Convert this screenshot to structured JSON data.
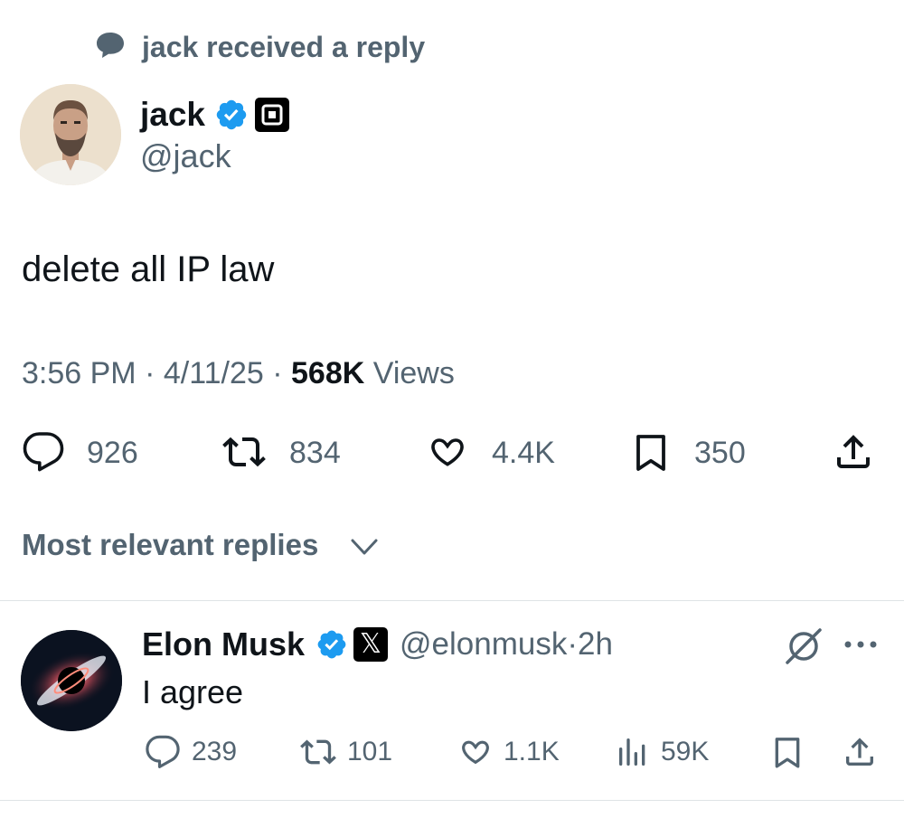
{
  "social_context": {
    "text": "jack received a reply"
  },
  "tweet": {
    "author_name": "jack",
    "author_handle": "@jack",
    "text": "delete all IP law",
    "time": "3:56 PM",
    "date": "4/11/25",
    "views_count": "568K",
    "views_label": "Views",
    "separator": "·",
    "stats": {
      "replies": "926",
      "retweets": "834",
      "likes": "4.4K",
      "bookmarks": "350"
    }
  },
  "replies_sort": {
    "label": "Most relevant replies"
  },
  "reply": {
    "author_name": "Elon Musk",
    "author_handle": "@elonmusk",
    "separator": "·",
    "age": "2h",
    "text": "I agree",
    "x_logo_text": "𝕏",
    "stats": {
      "replies": "239",
      "retweets": "101",
      "likes": "1.1K",
      "views": "59K"
    }
  },
  "colors": {
    "text_primary": "#0f1419",
    "text_secondary": "#536471",
    "verified_blue": "#1d9bf0",
    "divider": "#dfe3e6"
  },
  "icons": [
    "speech-bubble-icon",
    "verified-badge-icon",
    "square-logo-icon",
    "reply-icon",
    "retweet-icon",
    "like-icon",
    "bookmark-icon",
    "share-icon",
    "chevron-down-icon",
    "grok-icon",
    "more-icon",
    "views-icon",
    "x-logo-icon"
  ]
}
